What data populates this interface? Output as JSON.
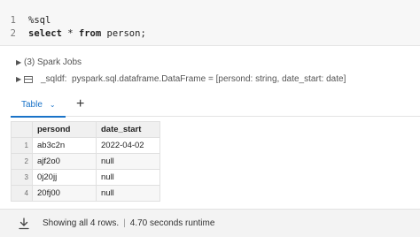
{
  "editor": {
    "lines": [
      {
        "number": "1",
        "text": "%sql"
      },
      {
        "number": "2",
        "keyword_select": "select",
        "star": " * ",
        "keyword_from": "from",
        "rest": " person;"
      }
    ]
  },
  "output": {
    "spark_jobs_label": "(3) Spark Jobs",
    "dataframe_name": "_sqldf:",
    "dataframe_type": "pyspark.sql.dataframe.DataFrame = [persond: string, date_start: date]"
  },
  "tabs": {
    "active_label": "Table",
    "add_symbol": "+"
  },
  "table": {
    "columns": [
      "persond",
      "date_start"
    ],
    "rows": [
      {
        "index": "1",
        "persond": "ab3c2n",
        "date_start": "2022-04-02"
      },
      {
        "index": "2",
        "persond": "ajf2o0",
        "date_start": "null"
      },
      {
        "index": "3",
        "persond": "0j20jj",
        "date_start": "null"
      },
      {
        "index": "4",
        "persond": "20fj00",
        "date_start": "null"
      }
    ]
  },
  "footer": {
    "rows_text": "Showing all 4 rows.",
    "separator": "|",
    "runtime_text": "4.70 seconds runtime"
  },
  "icons": {
    "jobs_chevron": "chevron-right-icon",
    "df_chevron": "chevron-right-icon",
    "df_icon": "dataframe-icon",
    "tab_chevron": "chevron-down-icon",
    "download": "download-icon"
  },
  "colors": {
    "accent": "#1a73c8",
    "editor_bg": "#f7f7f7",
    "footer_bg": "#f3f3f3"
  }
}
